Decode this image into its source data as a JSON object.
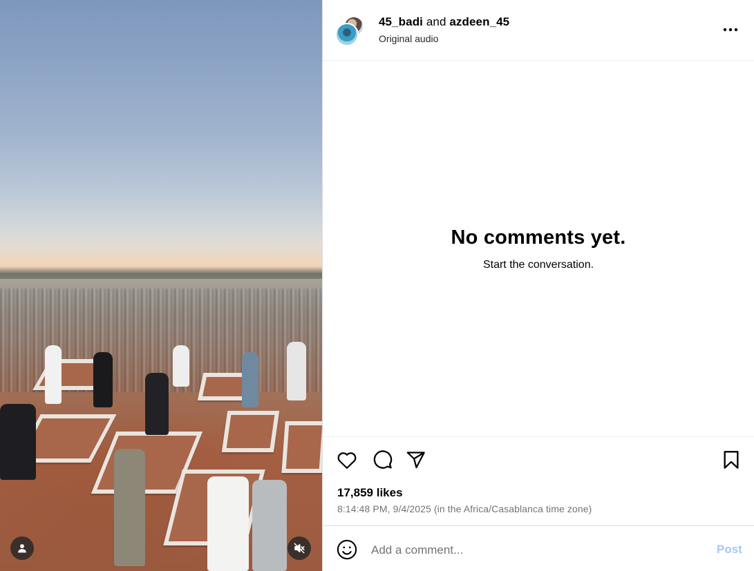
{
  "media": {
    "user_icon": "person-icon",
    "mute_icon": "speaker-muted-icon"
  },
  "header": {
    "user1": "45_badi",
    "conjunction": "and",
    "user2": "azdeen_45",
    "audio": "Original audio",
    "more_icon": "more-horizontal-icon"
  },
  "comments": {
    "empty_title": "No comments yet.",
    "empty_subtitle": "Start the conversation."
  },
  "actions": {
    "like_icon": "heart-icon",
    "comment_icon": "comment-bubble-icon",
    "share_icon": "paper-plane-icon",
    "save_icon": "bookmark-icon"
  },
  "stats": {
    "likes": "17,859 likes",
    "timestamp": "8:14:48 PM, 9/4/2025 (in the Africa/Casablanca time zone)"
  },
  "composer": {
    "emoji_icon": "smiley-icon",
    "placeholder": "Add a comment...",
    "post_label": "Post"
  },
  "colors": {
    "post_button": "#a6c8f7",
    "muted_text": "#737373",
    "border": "#dbdbdb"
  }
}
